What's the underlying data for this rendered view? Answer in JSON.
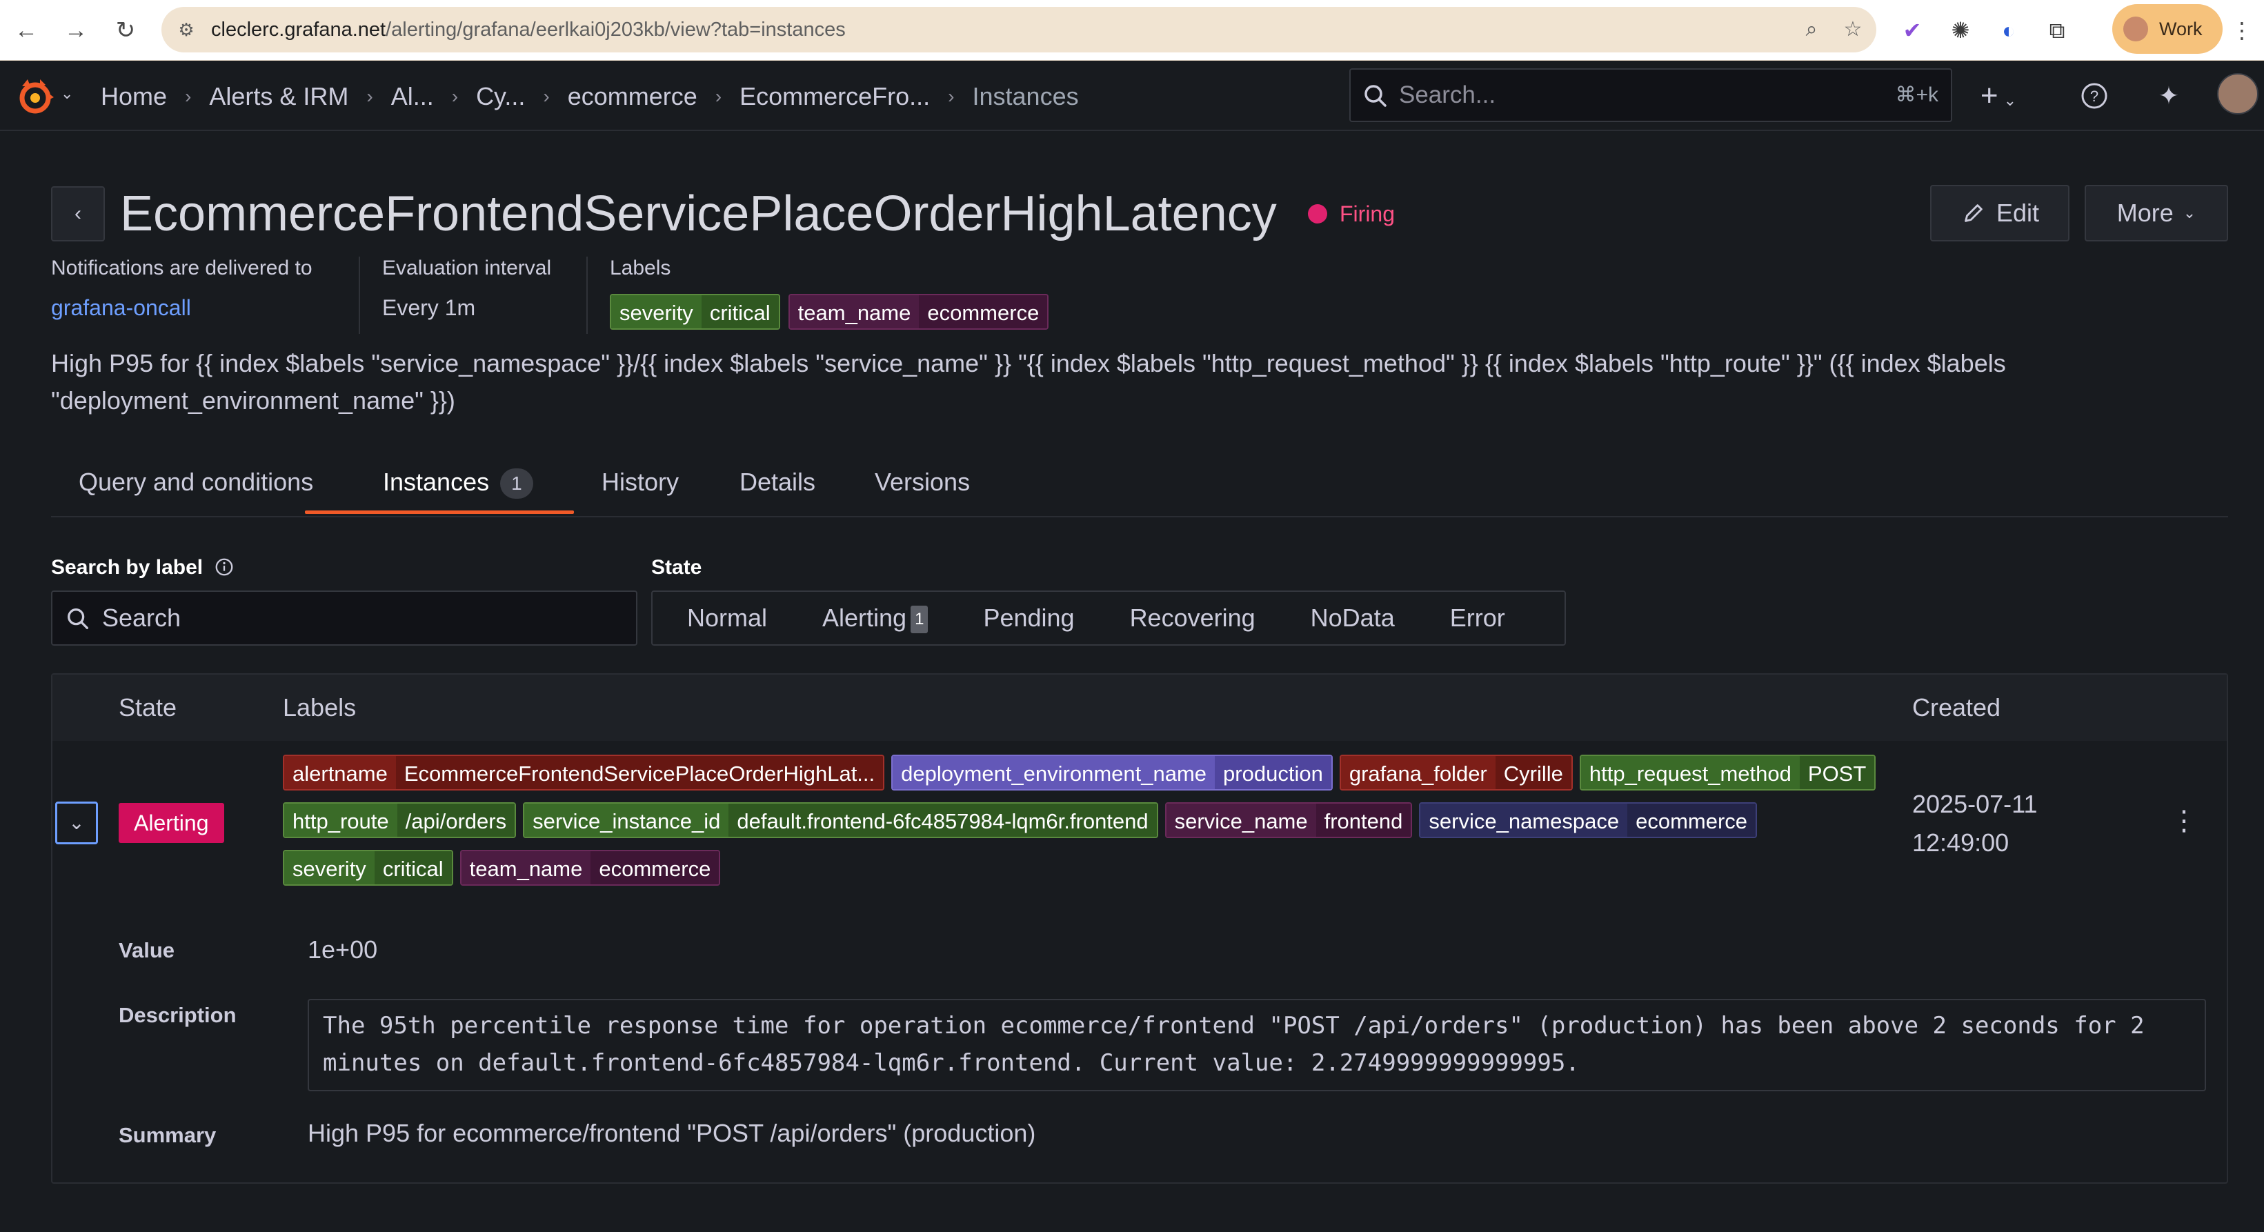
{
  "browser": {
    "url_host": "cleclerc.grafana.net",
    "url_path": "/alerting/grafana/eerlkai0j203kb/view?tab=instances",
    "profile_label": "Work"
  },
  "topnav": {
    "breadcrumbs": [
      "Home",
      "Alerts & IRM",
      "Al...",
      "Cy...",
      "ecommerce",
      "EcommerceFro...",
      "Instances"
    ],
    "search_placeholder": "Search...",
    "search_shortcut": "⌘+k",
    "add_label": "+"
  },
  "header": {
    "title": "EcommerceFrontendServicePlaceOrderHighLatency",
    "state": "Firing",
    "edit_label": "Edit",
    "more_label": "More"
  },
  "meta": {
    "notifications_label": "Notifications are delivered to",
    "notifications_value": "grafana-oncall",
    "interval_label": "Evaluation interval",
    "interval_value": "Every 1m",
    "labels_label": "Labels",
    "labels": [
      {
        "key": "severity",
        "value": "critical"
      },
      {
        "key": "team_name",
        "value": "ecommerce"
      }
    ]
  },
  "summary_template": "High P95 for {{ index $labels \"service_namespace\" }}/{{ index $labels \"service_name\" }} \"{{ index $labels \"http_request_method\" }} {{ index $labels \"http_route\" }}\" ({{ index $labels \"deployment_environment_name\" }})",
  "tabs": [
    {
      "label": "Query and conditions"
    },
    {
      "label": "Instances",
      "count": "1"
    },
    {
      "label": "History"
    },
    {
      "label": "Details"
    },
    {
      "label": "Versions"
    }
  ],
  "filters": {
    "search_label": "Search by label",
    "search_placeholder": "Search",
    "state_label": "State",
    "states": [
      "Normal",
      "Alerting",
      "Pending",
      "Recovering",
      "NoData",
      "Error"
    ],
    "alerting_count": "1"
  },
  "table": {
    "headers": {
      "state": "State",
      "labels": "Labels",
      "created": "Created"
    },
    "row": {
      "state": "Alerting",
      "labels": [
        {
          "key": "alertname",
          "value": "EcommerceFrontendServicePlaceOrderHighLat..."
        },
        {
          "key": "deployment_environment_name",
          "value": "production"
        },
        {
          "key": "grafana_folder",
          "value": "Cyrille"
        },
        {
          "key": "http_request_method",
          "value": "POST"
        },
        {
          "key": "http_route",
          "value": "/api/orders"
        },
        {
          "key": "service_instance_id",
          "value": "default.frontend-6fc4857984-lqm6r.frontend"
        },
        {
          "key": "service_name",
          "value": "frontend"
        },
        {
          "key": "service_namespace",
          "value": "ecommerce"
        },
        {
          "key": "severity",
          "value": "critical"
        },
        {
          "key": "team_name",
          "value": "ecommerce"
        }
      ],
      "created_date": "2025-07-11",
      "created_time": "12:49:00",
      "value_label": "Value",
      "value": "1e+00",
      "description_label": "Description",
      "description": "The 95th percentile response time for operation ecommerce/frontend \"POST /api/orders\" (production) has been above 2 seconds for 2 minutes on default.frontend-6fc4857984-lqm6r.frontend. Current value: 2.2749999999999995.",
      "summary_label": "Summary",
      "summary": "High P95 for ecommerce/frontend \"POST /api/orders\" (production)"
    }
  },
  "colors": {
    "accent_orange": "#f05a28",
    "firing": "#ff5286",
    "alerting_bg": "#d10e5c",
    "link": "#6e9fff"
  }
}
